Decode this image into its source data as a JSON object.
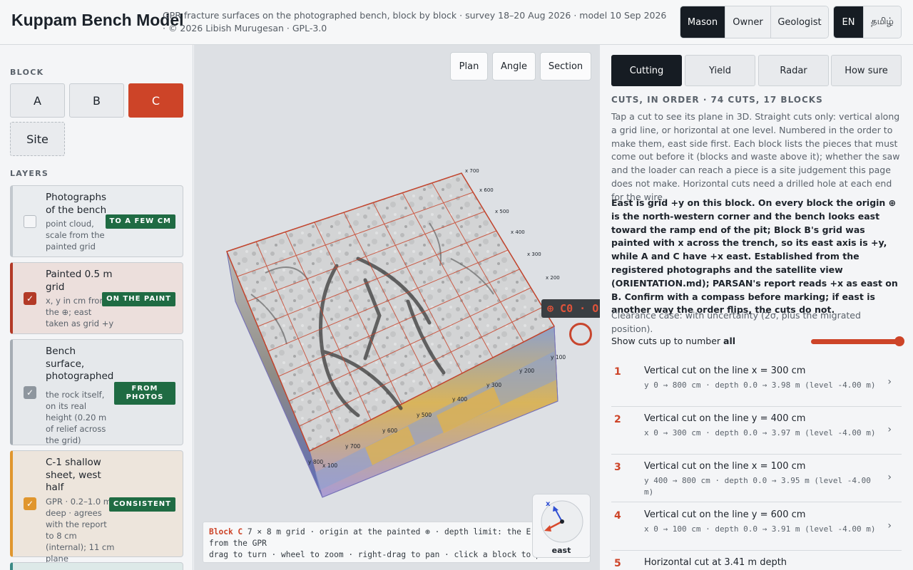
{
  "app": {
    "title": "Kuppam Bench Model",
    "subtitle": "GPR fracture surfaces on the photographed bench, block by block · survey 18–20 Aug 2026 · model 10 Sep 2026 · © 2026 Libish Murugesan · GPL-3.0"
  },
  "roles": [
    {
      "label": "Mason",
      "active": true
    },
    {
      "label": "Owner",
      "active": false
    },
    {
      "label": "Geologist",
      "active": false
    }
  ],
  "languages": [
    {
      "label": "EN",
      "active": true
    },
    {
      "label": "தமிழ்",
      "active": false
    }
  ],
  "left": {
    "block_heading": "BLOCK",
    "blocks": [
      {
        "label": "A",
        "active": false
      },
      {
        "label": "B",
        "active": false
      },
      {
        "label": "C",
        "active": true
      },
      {
        "label": "Site",
        "active": false
      }
    ],
    "layers_heading": "LAYERS",
    "layers": [
      {
        "title": "Photographs of the bench",
        "desc": "point cloud, scale from the painted grid",
        "badge": "TO A FEW CM",
        "checked": false,
        "accent": "#c2c8ce"
      },
      {
        "title": "Painted 0.5 m grid",
        "desc": "x, y in cm from the ⊕; east taken as grid +y",
        "badge": "ON THE PAINT",
        "checked": true,
        "accent": "#b33a27"
      },
      {
        "title": "Bench surface, photographed",
        "desc": "the rock itself, on its real height (0.20 m of relief across the grid)",
        "badge": "FROM PHOTOS",
        "checked": true,
        "accent": "#a6adb4"
      },
      {
        "title": "C-1 shallow sheet, west half",
        "desc": "GPR · 0.2–1.0 m deep · agrees with the report to 8 cm (internal); 11 cm plane",
        "badge": "CONSISTENT",
        "checked": true,
        "accent": "#e0962e"
      }
    ]
  },
  "viewer": {
    "buttons": [
      "Plan",
      "Angle",
      "Section"
    ],
    "origin_tag": "⊕ C0 · O",
    "grid_labels_x": [
      "x 700",
      "x 600",
      "x 500",
      "x 400",
      "x 300",
      "x 200",
      "x 100"
    ],
    "grid_labels_y": [
      "y 100",
      "y 200",
      "y 300",
      "y 400",
      "y 500",
      "y 600",
      "y 700",
      "y 800"
    ],
    "info_block": "Block C",
    "info_line1": " 7 × 8 m grid · origin at the painted ⊕ · depth limit: the E",
    "info_line2": "from the GPR",
    "info_line3": "drag to turn · wheel to zoom · right-drag to pan · click a block to pick it",
    "compass_label": "east",
    "compass_axis": "x"
  },
  "right": {
    "tabs": [
      {
        "label": "Cutting",
        "active": true
      },
      {
        "label": "Yield",
        "active": false
      },
      {
        "label": "Radar",
        "active": false
      },
      {
        "label": "How sure",
        "active": false
      }
    ],
    "cuts_heading": "CUTS, IN ORDER · 74 CUTS, 17 BLOCKS",
    "para1": "Tap a cut to see its plane in 3D. Straight cuts only: vertical along a grid line, or horizontal at one level. Numbered in the order to make them, east side first. Each block lists the pieces that must come out before it (blocks and waste above it); whether the saw and the loader can reach a piece is a site judgement this page does not make. Horizontal cuts need a drilled hole at each end for the wire.",
    "para2": "East is grid +y on this block. On every block the origin ⊕ is the north-western corner and the bench looks east toward the ramp end of the pit; Block B's grid was painted with x across the trench, so its east axis is +y, while A and C have +x east. Established from the registered photographs and the satellite view (ORIENTATION.md); PARSAN's report reads +x as east on B. Confirm with a compass before marking; if east is another way the order flips, the cuts do not.",
    "para3": "Clearance case: with uncertainty (2σ, plus the migrated position).",
    "slider_label": "Show cuts up to number",
    "slider_value": "all",
    "slider_fraction": 1.0,
    "cuts": [
      {
        "num": "1",
        "title": "Vertical cut on the line x = 300 cm",
        "detail": "y 0 → 800 cm · depth 0.0 → 3.98 m (level -4.00 m)"
      },
      {
        "num": "2",
        "title": "Vertical cut on the line y = 400 cm",
        "detail": "x 0 → 300 cm · depth 0.0 → 3.97 m (level -4.00 m)"
      },
      {
        "num": "3",
        "title": "Vertical cut on the line x = 100 cm",
        "detail": "y 400 → 800 cm · depth 0.0 → 3.95 m (level -4.00 m)"
      },
      {
        "num": "4",
        "title": "Vertical cut on the line y = 600 cm",
        "detail": "x 0 → 100 cm · depth 0.0 → 3.91 m (level -4.00 m)"
      },
      {
        "num": "5",
        "title": "Horizontal cut at 3.41 m depth",
        "detail": ""
      }
    ]
  }
}
